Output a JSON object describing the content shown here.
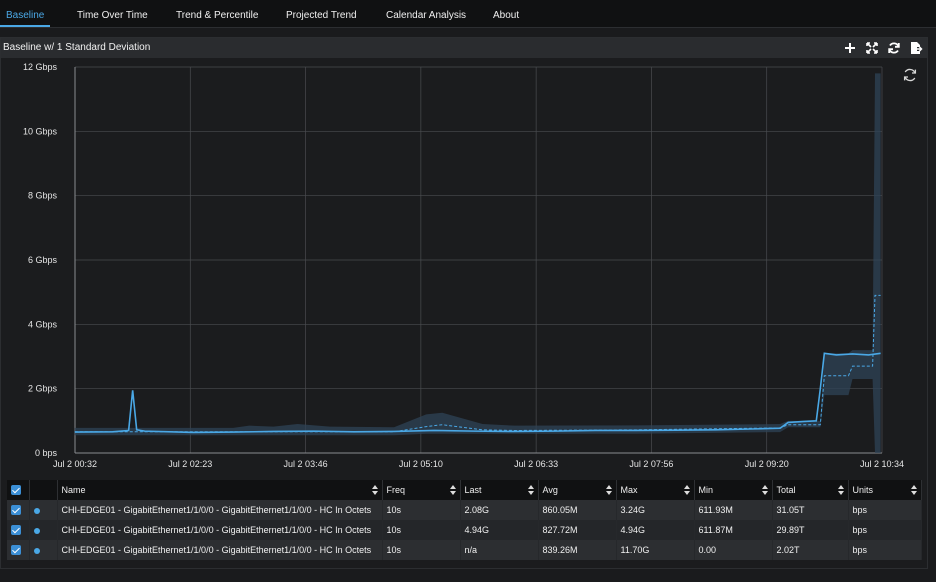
{
  "tabs": [
    {
      "label": "Baseline",
      "active": true
    },
    {
      "label": "Time Over Time",
      "active": false
    },
    {
      "label": "Trend & Percentile",
      "active": false
    },
    {
      "label": "Projected Trend",
      "active": false
    },
    {
      "label": "Calendar Analysis",
      "active": false
    },
    {
      "label": "About",
      "active": false
    }
  ],
  "panel": {
    "title": "Baseline w/ 1 Standard Deviation",
    "icons": [
      "add-icon",
      "fullscreen-icon",
      "refresh-icon",
      "export-icon"
    ]
  },
  "colors": {
    "accent": "#4aa8e6",
    "series": "#4aa8e6",
    "band": "#2f4357",
    "background": "#1b1c1e",
    "grid": "#4a4c50"
  },
  "chart_data": {
    "type": "line",
    "title": "",
    "ylim": [
      0,
      12
    ],
    "y_ticks": [
      "0 bps",
      "2 Gbps",
      "4 Gbps",
      "6 Gbps",
      "8 Gbps",
      "10 Gbps",
      "12 Gbps"
    ],
    "y_unit": "Gbps",
    "x_ticks": [
      "Jul 2 00:32",
      "Jul 2 02:23",
      "Jul 2 03:46",
      "Jul 2 05:10",
      "Jul 2 06:33",
      "Jul 2 07:56",
      "Jul 2 09:20",
      "Jul 2 10:34"
    ],
    "x_range_hours": [
      0.533,
      10.567
    ],
    "grid": true,
    "series": [
      {
        "name": "CHI-EDGE01 - GigabitEthernet1/1/0/0 - GigabitEthernet1/1/0/0 - HC In Octets",
        "style": "solid",
        "x_hours": [
          0.53,
          1.0,
          1.2,
          1.25,
          1.3,
          1.4,
          2.0,
          2.5,
          3.0,
          3.5,
          4.0,
          4.5,
          5.0,
          5.5,
          6.0,
          6.5,
          7.0,
          7.5,
          8.0,
          8.5,
          9.0,
          9.3,
          9.4,
          9.6,
          9.75,
          9.8,
          9.85,
          10.0,
          10.2,
          10.4,
          10.55
        ],
        "values": [
          0.65,
          0.66,
          0.7,
          1.95,
          0.72,
          0.68,
          0.64,
          0.65,
          0.67,
          0.68,
          0.66,
          0.67,
          0.7,
          0.68,
          0.67,
          0.68,
          0.7,
          0.7,
          0.71,
          0.72,
          0.75,
          0.77,
          0.95,
          0.98,
          1.0,
          2.0,
          3.1,
          3.05,
          3.08,
          3.05,
          3.1
        ]
      },
      {
        "name": "Baseline",
        "style": "dashed",
        "x_hours": [
          0.53,
          4.5,
          4.9,
          5.1,
          5.6,
          6.0,
          7.5,
          9.3,
          9.4,
          9.8,
          9.85,
          10.15,
          10.2,
          10.45,
          10.48,
          10.55
        ],
        "values": [
          0.66,
          0.66,
          0.82,
          0.88,
          0.72,
          0.7,
          0.72,
          0.78,
          0.88,
          0.88,
          2.4,
          2.4,
          2.7,
          2.7,
          4.9,
          4.9
        ]
      }
    ],
    "band": {
      "x_hours": [
        0.53,
        2.5,
        2.7,
        3.0,
        3.3,
        3.7,
        4.5,
        4.9,
        5.1,
        5.6,
        6.0,
        7.5,
        9.3,
        9.4,
        9.8,
        9.85,
        10.15,
        10.2,
        10.45,
        10.48,
        10.55
      ],
      "upper": [
        0.78,
        0.78,
        0.85,
        0.82,
        0.9,
        0.82,
        0.8,
        1.2,
        1.25,
        0.9,
        0.85,
        0.86,
        0.9,
        1.0,
        1.0,
        3.1,
        3.1,
        3.2,
        3.2,
        11.8,
        11.8
      ],
      "lower": [
        0.55,
        0.55,
        0.55,
        0.55,
        0.55,
        0.55,
        0.55,
        0.6,
        0.6,
        0.6,
        0.6,
        0.6,
        0.65,
        0.8,
        0.8,
        1.8,
        1.8,
        2.3,
        2.3,
        0.0,
        0.0
      ]
    }
  },
  "legend": {
    "columns": [
      "Name",
      "Freq",
      "Last",
      "Avg",
      "Max",
      "Min",
      "Total",
      "Units"
    ],
    "rows": [
      {
        "name": "CHI-EDGE01 - GigabitEthernet1/1/0/0 - GigabitEthernet1/1/0/0 - HC In Octets",
        "freq": "10s",
        "last": "2.08G",
        "avg": "860.05M",
        "max": "3.24G",
        "min": "611.93M",
        "total": "31.05T",
        "units": "bps"
      },
      {
        "name": "CHI-EDGE01 - GigabitEthernet1/1/0/0 - GigabitEthernet1/1/0/0 - HC In Octets",
        "freq": "10s",
        "last": "4.94G",
        "avg": "827.72M",
        "max": "4.94G",
        "min": "611.87M",
        "total": "29.89T",
        "units": "bps"
      },
      {
        "name": "CHI-EDGE01 - GigabitEthernet1/1/0/0 - GigabitEthernet1/1/0/0 - HC In Octets",
        "freq": "10s",
        "last": "n/a",
        "avg": "839.26M",
        "max": "11.70G",
        "min": "0.00",
        "total": "2.02T",
        "units": "bps"
      }
    ]
  }
}
